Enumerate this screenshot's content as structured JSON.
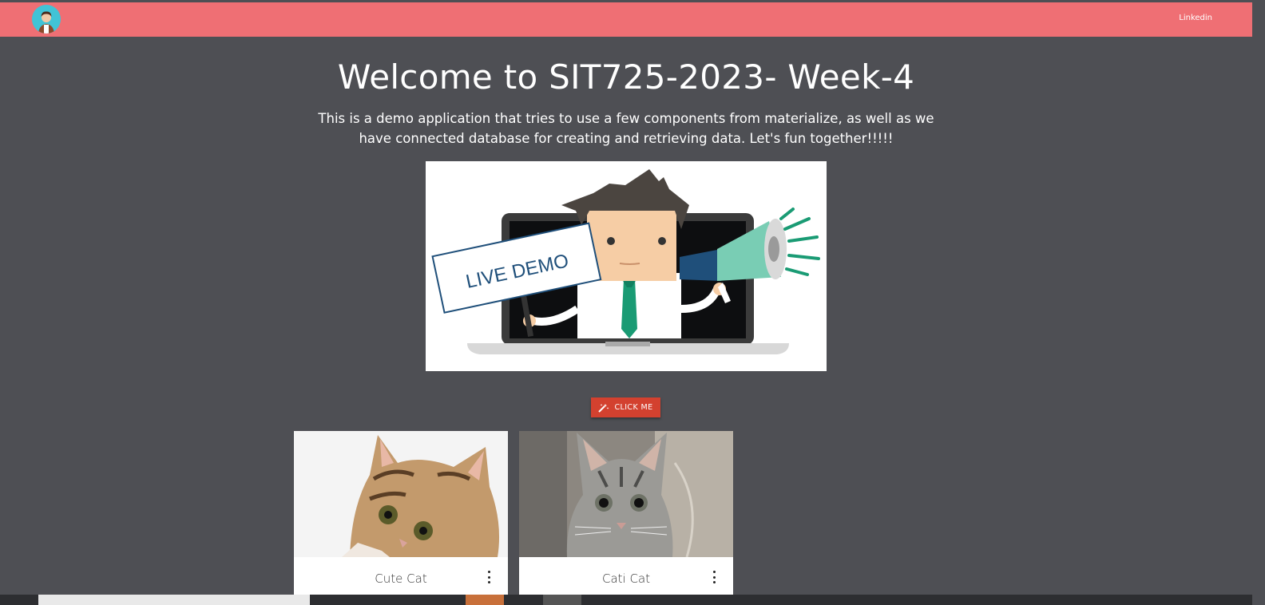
{
  "nav": {
    "linkedin_label": "Linkedin"
  },
  "main": {
    "title": "Welcome to SIT725-2023- Week-4",
    "subtitle": "This is a demo application that tries to use a few components from materialize, as well as we have connected database for creating and retrieving data. Let's fun together!!!!!",
    "hero_sign_text": "LIVE DEMO",
    "button_label": "CLICK ME",
    "button_icon": "wand-icon"
  },
  "cards": [
    {
      "title": "Cute Cat"
    },
    {
      "title": "Cati Cat"
    }
  ],
  "colors": {
    "navbar": "#ef6f74",
    "background": "#4e4f54",
    "button": "#d3412f",
    "tie": "#1a9b74"
  }
}
